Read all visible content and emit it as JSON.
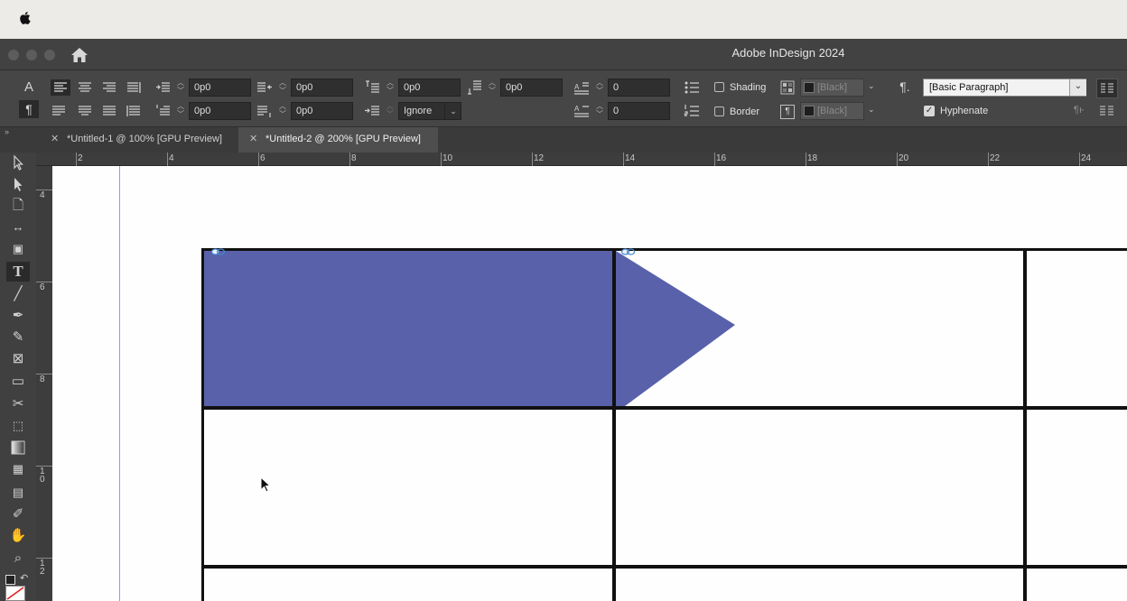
{
  "window": {
    "title": "Adobe InDesign 2024"
  },
  "control_panel": {
    "indent_left": "0p0",
    "indent_right": "0p0",
    "first_line_indent": "0p0",
    "last_line_indent": "0p0",
    "space_before": "0p0",
    "space_after": "0p0",
    "align_to_grid": "Ignore",
    "drop_cap_lines": "0",
    "drop_cap_chars": "0",
    "shading_label": "Shading",
    "border_label": "Border",
    "shading_swatch": "[Black]",
    "border_swatch": "[Black]",
    "paragraph_style": "[Basic Paragraph]",
    "hyphenate_label": "Hyphenate",
    "hyphenate_checked": true,
    "shading_checked": false,
    "border_checked": false
  },
  "tabs": [
    {
      "label": "*Untitled-1 @ 100% [GPU Preview]",
      "active": false
    },
    {
      "label": "*Untitled-2 @ 200% [GPU Preview]",
      "active": true
    }
  ],
  "rulers": {
    "horizontal": [
      "2",
      "4",
      "6",
      "8",
      "10",
      "12",
      "14",
      "16",
      "18",
      "20",
      "22",
      "24"
    ],
    "vertical": [
      "4",
      "6",
      "8",
      "1\n0",
      "1\n2"
    ]
  },
  "tools": [
    "selection-tool",
    "direct-selection-tool",
    "page-tool",
    "gap-tool",
    "content-collector-tool",
    "type-tool",
    "line-tool",
    "pen-tool",
    "pencil-tool",
    "rectangle-frame-tool",
    "rectangle-tool",
    "scissors-tool",
    "free-transform-tool",
    "gradient-swatch-tool",
    "gradient-feather-tool",
    "note-tool",
    "eyedropper-tool",
    "hand-tool",
    "zoom-tool"
  ],
  "colors": {
    "accent_fill": "#5861aa",
    "margin_guide": "#c77de6"
  }
}
